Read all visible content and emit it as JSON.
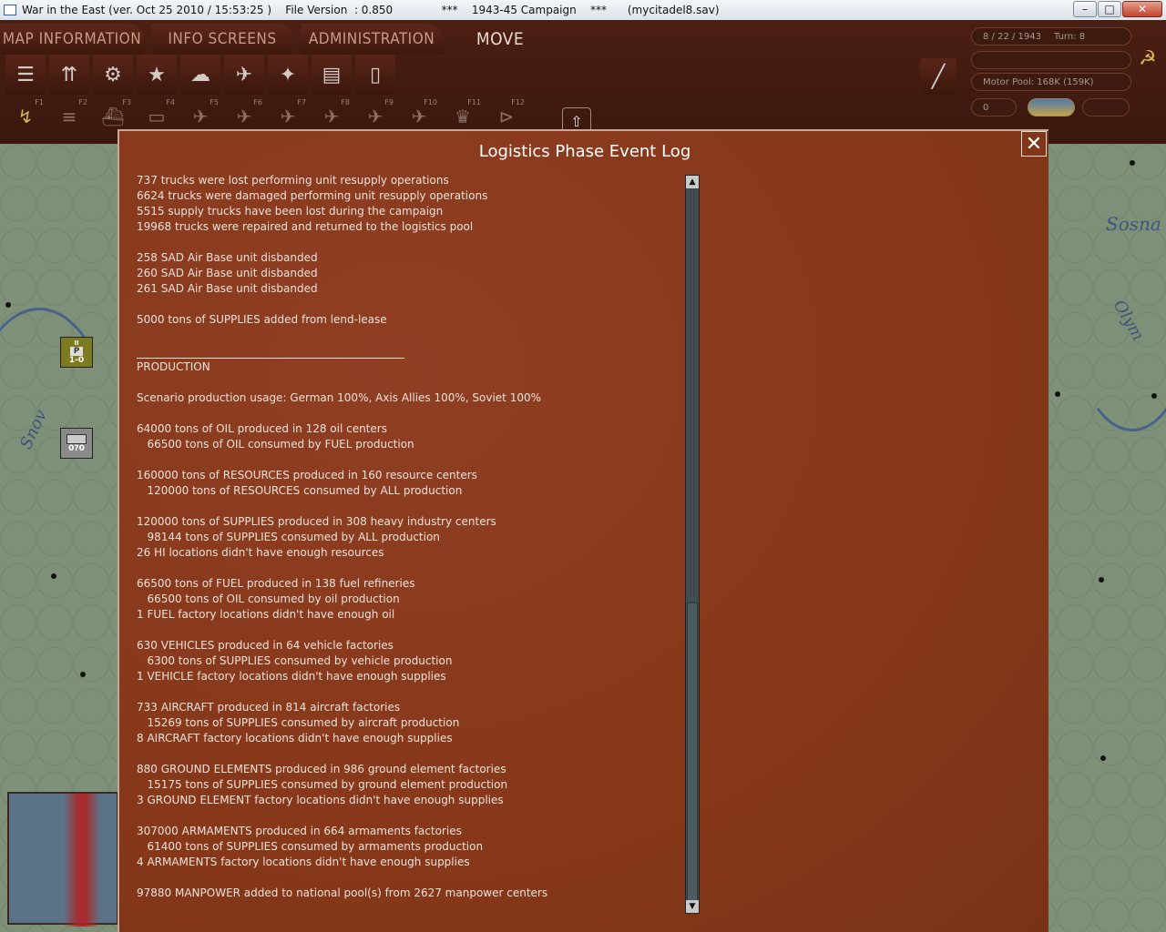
{
  "window": {
    "title": "War in the East (ver. Oct 25 2010 / 15:53:25 )    File Version  : 0.850              ***    1943-45 Campaign    ***      (mycitadel8.sav)",
    "minimize": "–",
    "maximize": "□",
    "close": "✕"
  },
  "menu": {
    "tabs": [
      {
        "label": "MAP INFORMATION"
      },
      {
        "label": "INFO SCREENS"
      },
      {
        "label": "ADMINISTRATION"
      },
      {
        "label": "MOVE"
      }
    ]
  },
  "toolbar": {
    "row1_icons": [
      "tank-list-icon",
      "unit-stack-icon",
      "gear-icon",
      "star-icon",
      "weather-icon",
      "air-missions-icon",
      "satellite-icon",
      "rail-icon",
      "phone-icon"
    ],
    "row2": [
      {
        "icon": "movement-icon",
        "fkey": "F1"
      },
      {
        "icon": "rail-move-icon",
        "fkey": "F2"
      },
      {
        "icon": "naval-move-icon",
        "fkey": "F3"
      },
      {
        "icon": "sea-transport-icon",
        "fkey": "F4"
      },
      {
        "icon": "air-attack-icon",
        "fkey": "F5"
      },
      {
        "icon": "airfield-icon",
        "fkey": "F6"
      },
      {
        "icon": "air-supply-icon",
        "fkey": "F7"
      },
      {
        "icon": "air-drop-icon",
        "fkey": "F8"
      },
      {
        "icon": "bomber-icon",
        "fkey": "F9"
      },
      {
        "icon": "recon-icon",
        "fkey": "F10"
      },
      {
        "icon": "fortify-icon",
        "fkey": "F11"
      },
      {
        "icon": "end-turn-icon",
        "fkey": "F12"
      }
    ]
  },
  "status": {
    "date": "8 / 22 / 1943",
    "turn": "Turn: 8",
    "motor_pool": "Motor Pool:  168K (159K)",
    "counter": "0"
  },
  "map": {
    "labels": [
      "Sosna",
      "Olym",
      "Snov"
    ],
    "unit_p_top": "II",
    "unit_p_letter": "P",
    "unit_p_strength": "1-0",
    "unit_gray_strength": "0?0"
  },
  "dialog": {
    "title": "Logistics Phase Event Log",
    "close": "✕",
    "lines": [
      "737 trucks were lost performing unit resupply operations",
      "6624 trucks were damaged performing unit resupply operations",
      "5515 supply trucks have been lost during the campaign",
      "19968 trucks were repaired and returned to the logistics pool",
      "",
      "258 SAD Air Base unit disbanded",
      "260 SAD Air Base unit disbanded",
      "261 SAD Air Base unit disbanded",
      "",
      "5000 tons of SUPPLIES added from lend-lease",
      "",
      "__RULE__",
      "PRODUCTION",
      "",
      "Scenario production usage: German 100%, Axis Allies 100%, Soviet 100%",
      "",
      "64000 tons of OIL produced in 128 oil centers",
      "   66500 tons of OIL consumed by FUEL production",
      "",
      "160000 tons of RESOURCES produced in 160 resource centers",
      "   120000 tons of RESOURCES consumed by ALL production",
      "",
      "120000 tons of SUPPLIES produced in 308 heavy industry centers",
      "   98144 tons of SUPPLIES consumed by ALL production",
      "26 HI locations didn't have enough resources",
      "",
      "66500 tons of FUEL produced in 138 fuel refineries",
      "   66500 tons of OIL consumed by oil production",
      "1 FUEL factory locations didn't have enough oil",
      "",
      "630 VEHICLES produced in 64 vehicle factories",
      "   6300 tons of SUPPLIES consumed by vehicle production",
      "1 VEHICLE factory locations didn't have enough supplies",
      "",
      "733 AIRCRAFT produced in 814 aircraft factories",
      "   15269 tons of SUPPLIES consumed by aircraft production",
      "8 AIRCRAFT factory locations didn't have enough supplies",
      "",
      "880 GROUND ELEMENTS produced in 986 ground element factories",
      "   15175 tons of SUPPLIES consumed by ground element production",
      "3 GROUND ELEMENT factory locations didn't have enough supplies",
      "",
      "307000 ARMAMENTS produced in 664 armaments factories",
      "   61400 tons of SUPPLIES consumed by armaments production",
      "4 ARMAMENTS factory locations didn't have enough supplies",
      "",
      "97880 MANPOWER added to national pool(s) from 2627 manpower centers"
    ],
    "scrollbar": {
      "up": "▲",
      "down": "▼",
      "thumb_position": 0.58,
      "thumb_size": 0.42
    }
  }
}
